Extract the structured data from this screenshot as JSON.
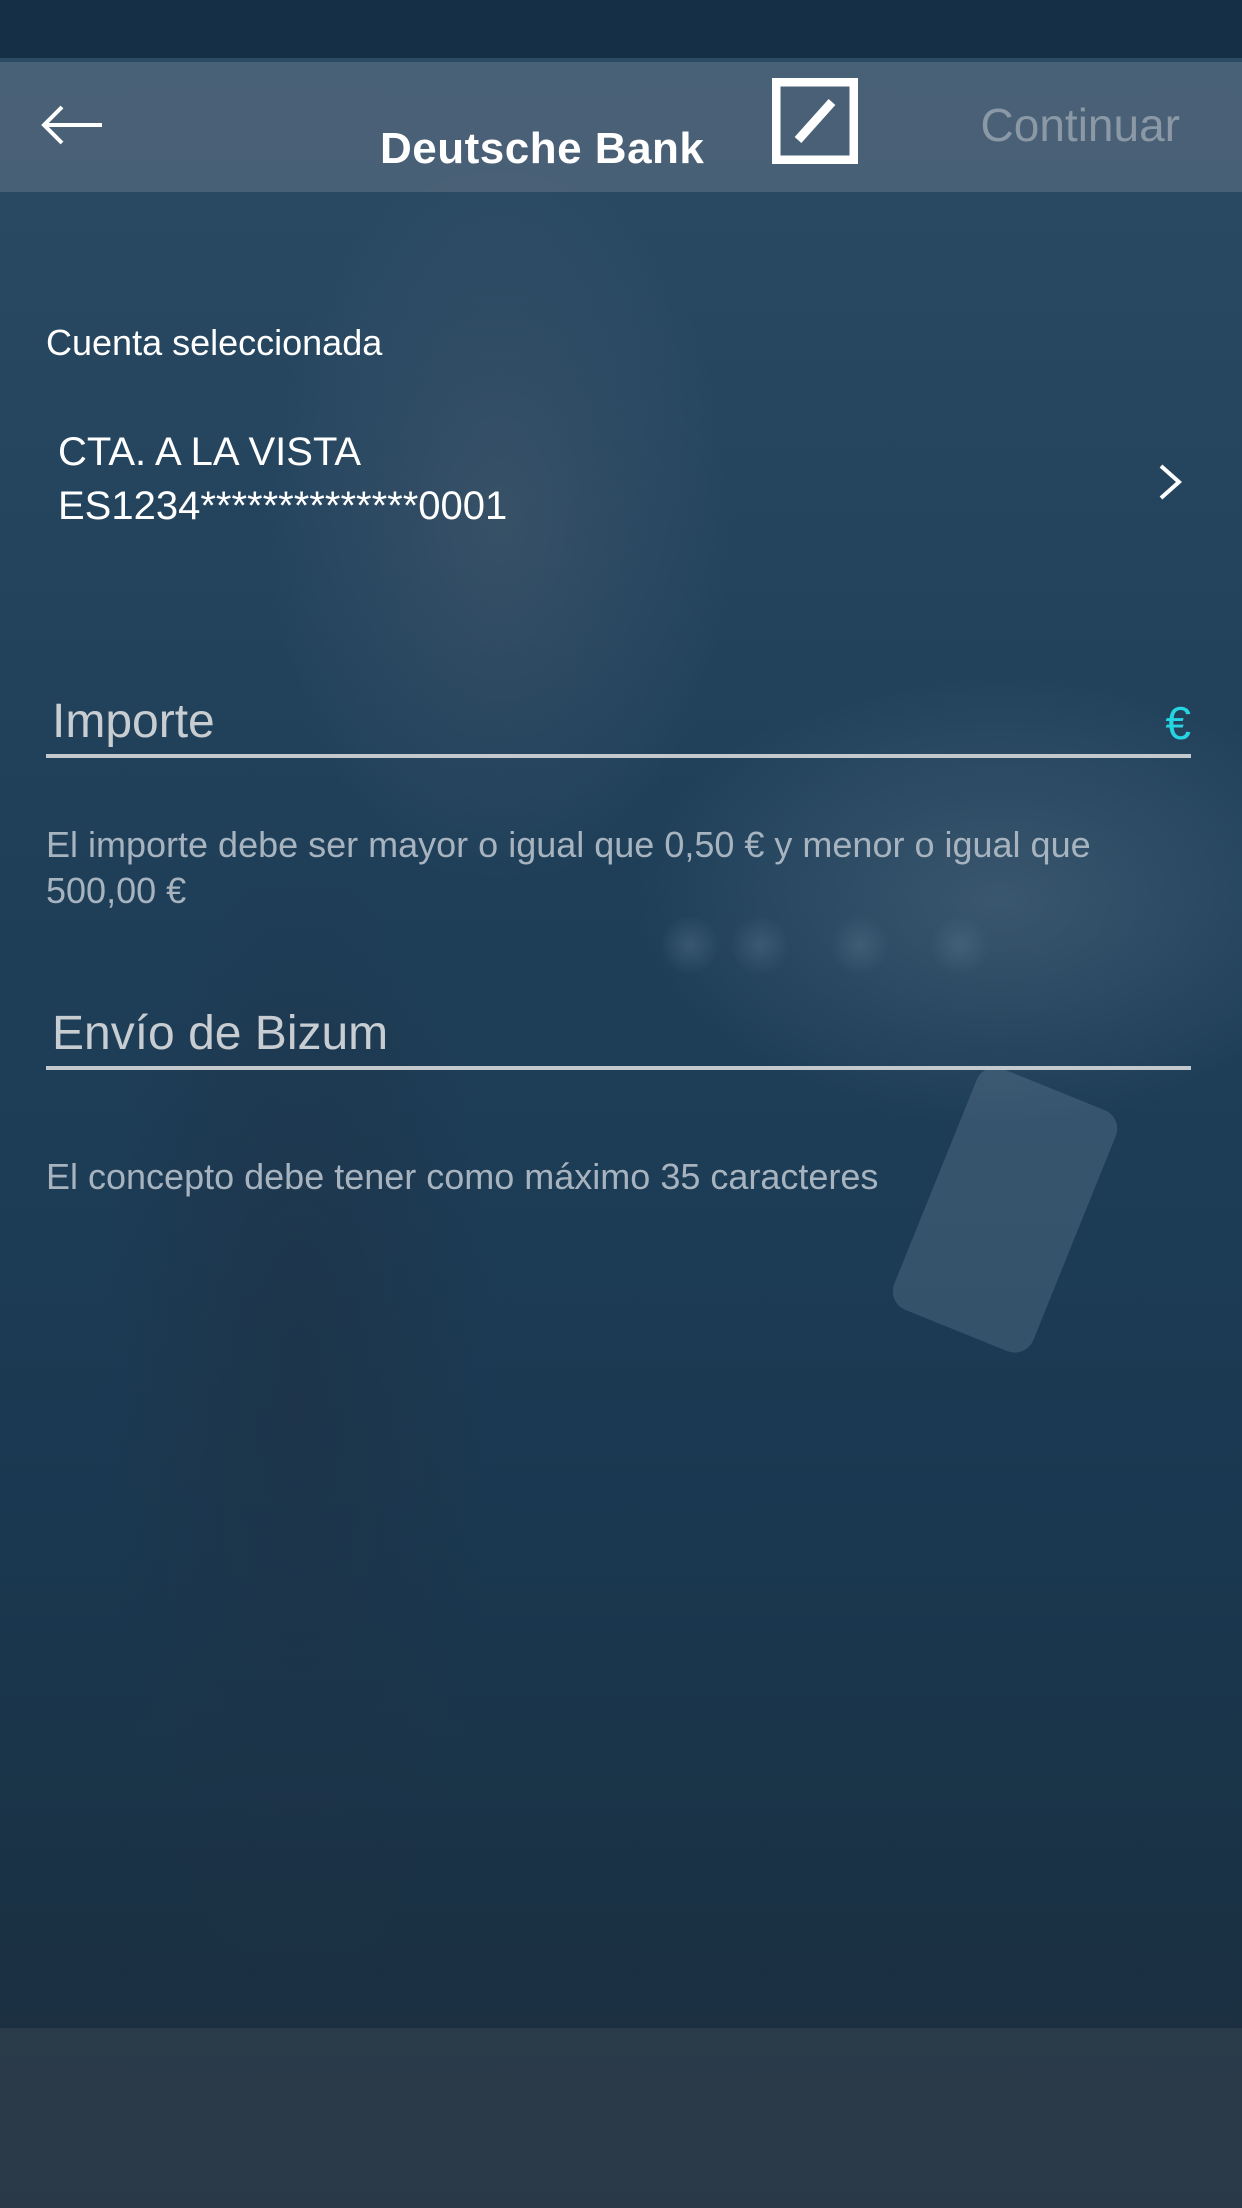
{
  "header": {
    "brand_name": "Deutsche Bank",
    "continue_label": "Continuar"
  },
  "account": {
    "section_label": "Cuenta seleccionada",
    "name": "CTA. A LA VISTA",
    "iban": "ES1234**************0001"
  },
  "amount_field": {
    "placeholder": "Importe",
    "currency_symbol": "€",
    "hint": "El importe debe ser mayor o igual que 0,50 € y menor o igual que 500,00 €"
  },
  "concept_field": {
    "placeholder": "Envío de Bizum",
    "hint": "El concepto debe tener como máximo 35 caracteres"
  },
  "colors": {
    "accent": "#27d4e2",
    "background": "#1c3a52",
    "continue_disabled": "#8b99a6"
  },
  "icons": {
    "back": "arrow-left-icon",
    "logo": "deutsche-bank-logo",
    "chevron": "chevron-right-icon"
  }
}
